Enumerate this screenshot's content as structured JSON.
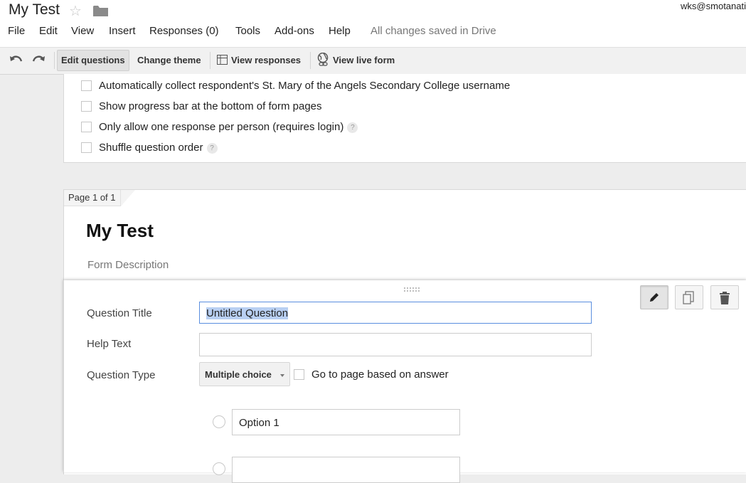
{
  "app": {
    "doc_title": "My Test",
    "user_email": "wks@smotanati"
  },
  "menu": {
    "items": [
      "File",
      "Edit",
      "View",
      "Insert",
      "Responses (0)",
      "Tools",
      "Add-ons",
      "Help"
    ],
    "save_status": "All changes saved in Drive"
  },
  "toolbar": {
    "undo_icon": "undo-icon",
    "redo_icon": "redo-icon",
    "edit_questions": "Edit questions",
    "change_theme": "Change theme",
    "view_responses": "View responses",
    "view_live_form": "View live form"
  },
  "settings": {
    "options": [
      {
        "label": "Automatically collect respondent's St. Mary of the Angels Secondary College username",
        "checked": false,
        "help": false
      },
      {
        "label": "Show progress bar at the bottom of form pages",
        "checked": false,
        "help": false
      },
      {
        "label": "Only allow one response per person (requires login)",
        "checked": false,
        "help": true
      },
      {
        "label": "Shuffle question order",
        "checked": false,
        "help": true
      }
    ],
    "help_glyph": "?"
  },
  "page": {
    "tab_label": "Page 1 of 1",
    "form_title": "My Test",
    "form_description_placeholder": "Form Description"
  },
  "question_editor": {
    "title_label": "Question Title",
    "title_value": "Untitled Question",
    "help_label": "Help Text",
    "help_value": "",
    "type_label": "Question Type",
    "type_value": "Multiple choice",
    "go_to_page_label": "Go to page based on answer",
    "go_to_page_checked": false,
    "options": [
      "Option 1",
      ""
    ],
    "actions": [
      "edit-icon",
      "duplicate-icon",
      "delete-icon"
    ]
  },
  "colors": {
    "accent_blue": "#5a8edf",
    "selection": "#b8cff2",
    "link": "#1155cc"
  }
}
